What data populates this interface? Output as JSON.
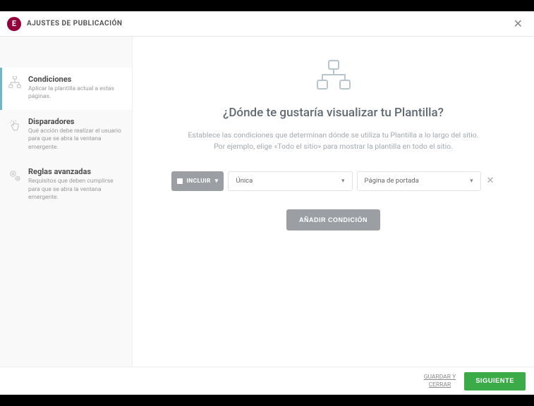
{
  "header": {
    "title": "AJUSTES DE PUBLICACIÓN"
  },
  "sidebar": {
    "items": [
      {
        "title": "Condiciones",
        "desc": "Aplicar la plantilla actual a estas páginas."
      },
      {
        "title": "Disparadores",
        "desc": "Qué acción debe realizar el usuario para que se abra la ventana emergente."
      },
      {
        "title": "Reglas avanzadas",
        "desc": "Requisitos que deben cumplirse para que se abra la ventana emergente."
      }
    ]
  },
  "main": {
    "heading": "¿Dónde te gustaría visualizar tu Plantilla?",
    "sub1": "Establece las condiciones que determinan dónde se utiliza tu Plantilla a lo largo del sitio.",
    "sub2": "Por ejemplo, elige «Todo el sitio» para mostrar la plantilla en todo el sitio.",
    "condition": {
      "mode_label": "INCLUIR",
      "select1": "Única",
      "select2": "Página de portada"
    },
    "add_button": "AÑADIR CONDICIÓN"
  },
  "footer": {
    "save_close_line1": "GUARDAR Y",
    "save_close_line2": "CERRAR",
    "next": "SIGUIENTE"
  }
}
